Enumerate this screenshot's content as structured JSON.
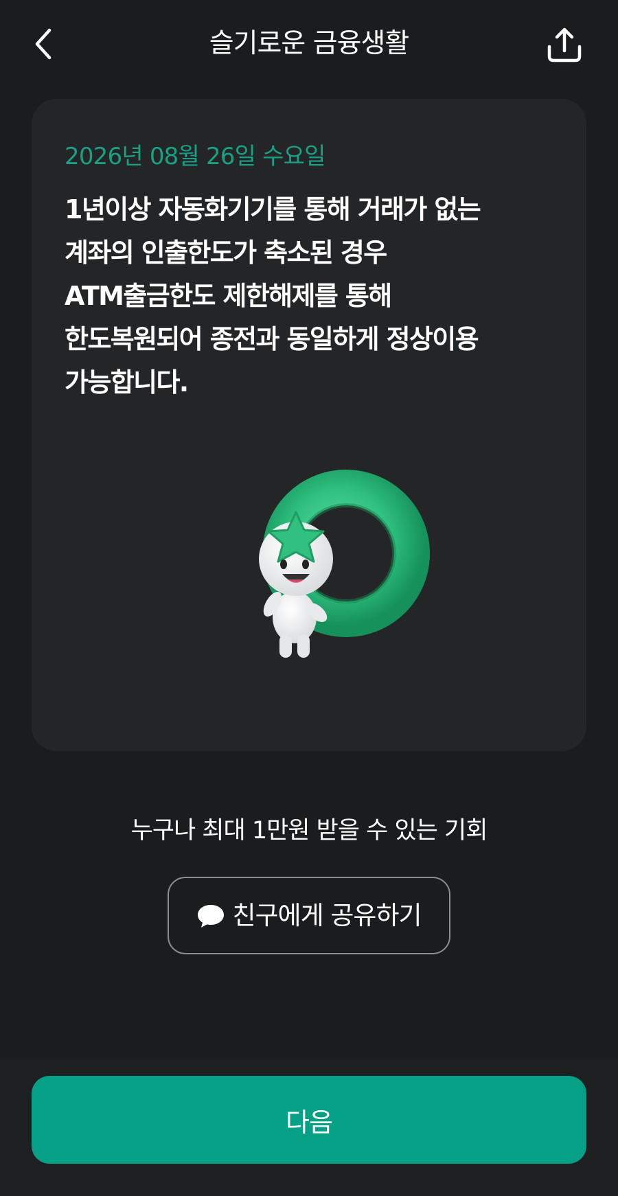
{
  "header": {
    "title": "슬기로운 금융생활",
    "back_icon": "chevron-left-icon",
    "share_icon": "share-upload-icon"
  },
  "card": {
    "date": "2026년 08월 26일 수요일",
    "message_lines": [
      "1년이상 자동화기기를 통해 거래가 없는",
      "계좌의 인출한도가 축소된 경우",
      "ATM출금한도 제한해제를 통해",
      "한도복원되어 종전과 동일하게 정상이용",
      "가능합니다."
    ],
    "mascot": "star-character-with-ring"
  },
  "promo": {
    "text": "누구나 최대 1만원 받을 수 있는 기회",
    "share_button_label": "친구에게 공유하기",
    "share_button_icon": "chat-bubble-icon"
  },
  "footer": {
    "next_label": "다음"
  },
  "colors": {
    "background": "#1b1c1e",
    "card": "#242527",
    "accent_green": "#05a085",
    "date_green": "#18a184"
  }
}
